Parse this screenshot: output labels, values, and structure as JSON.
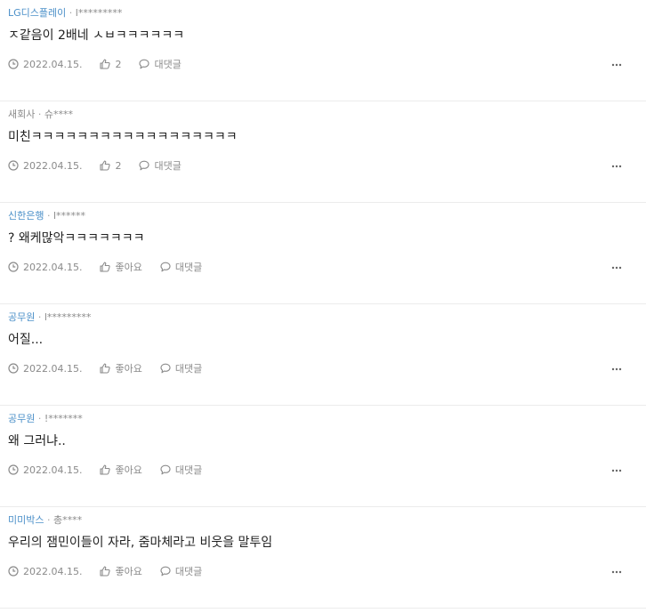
{
  "comments": [
    {
      "company": "LG디스플레이",
      "company_style": "blue",
      "separator": "·",
      "username": "l*********",
      "text": "ㅈ같음이 2배네 ㅅㅂㅋㅋㅋㅋㅋㅋ",
      "date": "2022.04.15.",
      "likes": "2",
      "reply_label": "대댓글",
      "more_icon": "more-horizontal-icon"
    },
    {
      "company": "새회사",
      "company_style": "gray",
      "separator": "·",
      "username": "슈****",
      "text": "미친ㅋㅋㅋㅋㅋㅋㅋㅋㅋㅋㅋㅋㅋㅋㅋㅋㅋㅋ",
      "date": "2022.04.15.",
      "likes": "2",
      "reply_label": "대댓글",
      "more_icon": "more-horizontal-icon"
    },
    {
      "company": "신한은행",
      "company_style": "blue",
      "separator": "·",
      "username": "l******",
      "text": "? 왜케많악ㅋㅋㅋㅋㅋㅋㅋ",
      "date": "2022.04.15.",
      "likes": "좋아요",
      "reply_label": "대댓글",
      "more_icon": "more-horizontal-icon"
    },
    {
      "company": "공무원",
      "company_style": "blue",
      "separator": "·",
      "username": "l*********",
      "text": "어질...",
      "date": "2022.04.15.",
      "likes": "좋아요",
      "reply_label": "대댓글",
      "more_icon": "more-horizontal-icon"
    },
    {
      "company": "공무원",
      "company_style": "blue",
      "separator": "·",
      "username": "!*******",
      "text": "왜 그러냐..",
      "date": "2022.04.15.",
      "likes": "좋아요",
      "reply_label": "대댓글",
      "more_icon": "more-horizontal-icon"
    },
    {
      "company": "미미박스",
      "company_style": "blue",
      "separator": "·",
      "username": "총****",
      "text": "우리의 잼민이들이 자라, 줌마체라고 비웃을 말투임",
      "date": "2022.04.15.",
      "likes": "좋아요",
      "reply_label": "대댓글",
      "more_icon": "more-horizontal-icon"
    }
  ],
  "icons": {
    "date": "clock-icon",
    "like": "thumbs-up-icon",
    "reply": "speech-bubble-icon",
    "more": "more-horizontal-icon"
  },
  "colors": {
    "company": "#4a8fc8",
    "muted": "#8a8a8a",
    "text": "#222222",
    "divider": "#ececec"
  }
}
